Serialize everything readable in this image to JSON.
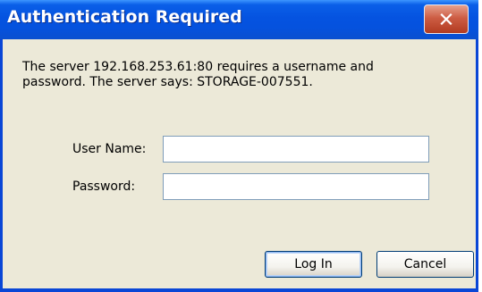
{
  "dialog": {
    "title": "Authentication Required",
    "close_glyph": "X",
    "close_icon": "close-icon",
    "message_line1": "The server 192.168.253.61:80 requires a username and",
    "message_line2": "password. The server says: STORAGE-007551.",
    "fields": {
      "username_label": "User Name:",
      "username_value": "",
      "password_label": "Password:",
      "password_value": ""
    },
    "buttons": {
      "login_label": "Log In",
      "cancel_label": "Cancel"
    }
  },
  "colors": {
    "titlebar": "#0553e0",
    "frame": "#0a46d6",
    "dialog_bg": "#ece9d8",
    "close_button": "#cd5d44",
    "input_border": "#7f9db9"
  }
}
